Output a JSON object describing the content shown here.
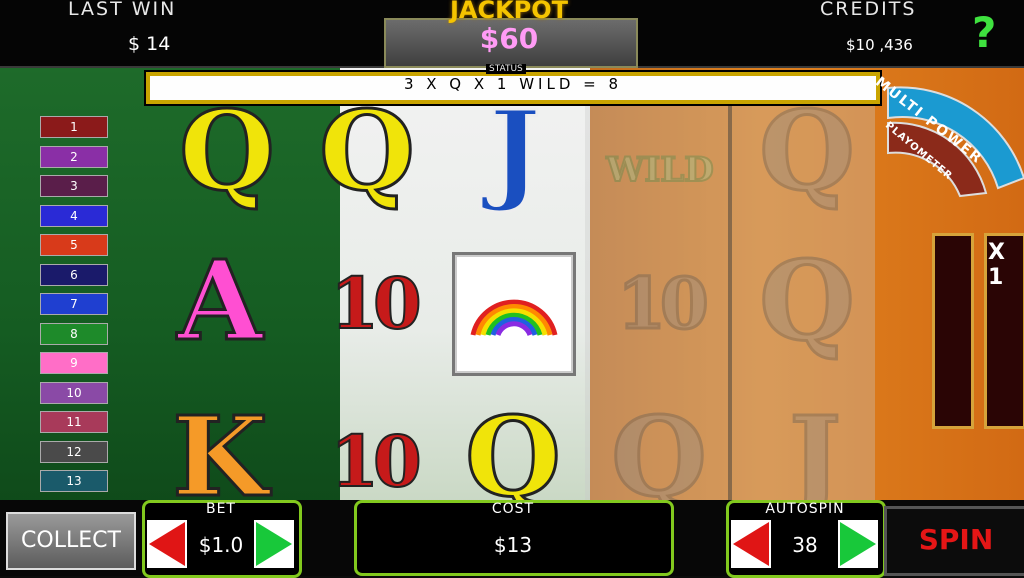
{
  "header": {
    "last_win_label": "LAST WIN",
    "last_win_value": "$ 14",
    "jackpot_label": "JACKPOT",
    "jackpot_value": "$60",
    "credits_label": "CREDITS",
    "credits_value": "$10 ,436",
    "help_label": "?"
  },
  "status": {
    "label": "STATUS",
    "text": "3 X Q X 1 WILD = 8"
  },
  "paylines": [
    {
      "label": "1",
      "color": "#8b1a1a"
    },
    {
      "label": "2",
      "color": "#8a2fa6"
    },
    {
      "label": "3",
      "color": "#5a1e4a"
    },
    {
      "label": "4",
      "color": "#2a2ad6"
    },
    {
      "label": "5",
      "color": "#d83a1a"
    },
    {
      "label": "6",
      "color": "#1a1a6a"
    },
    {
      "label": "7",
      "color": "#1f3fd0"
    },
    {
      "label": "8",
      "color": "#1e8a2a"
    },
    {
      "label": "9",
      "color": "#ff6ec7"
    },
    {
      "label": "10",
      "color": "#8a4aa6"
    },
    {
      "label": "11",
      "color": "#a83a5a"
    },
    {
      "label": "12",
      "color": "#4a4a4a"
    },
    {
      "label": "13",
      "color": "#1a5a6a"
    }
  ],
  "reels": {
    "col1": [
      "Q",
      "A",
      "K"
    ],
    "col2": [
      "Q",
      "10",
      "10"
    ],
    "col3": [
      "J",
      "rainbow",
      "Q"
    ],
    "col4": [
      "WILD",
      "10",
      "Q"
    ],
    "col5": [
      "Q",
      "Q",
      "J"
    ]
  },
  "side_panel": {
    "multi_power_label": "MULTI POWER",
    "playometer_label": "PLAYOMETER",
    "multiplier": "X 1"
  },
  "controls": {
    "collect_label": "COLLECT",
    "bet_label": "BET",
    "bet_value": "$1.0",
    "cost_label": "COST",
    "cost_value": "$13",
    "autospin_label": "AUTOSPIN",
    "autospin_value": "38",
    "spin_label": "SPIN"
  },
  "colors": {
    "accent_green": "#82c91e",
    "jackpot_gold": "#f5c400",
    "jackpot_value_pink": "#ff9bf5",
    "spin_red": "#e51616"
  }
}
